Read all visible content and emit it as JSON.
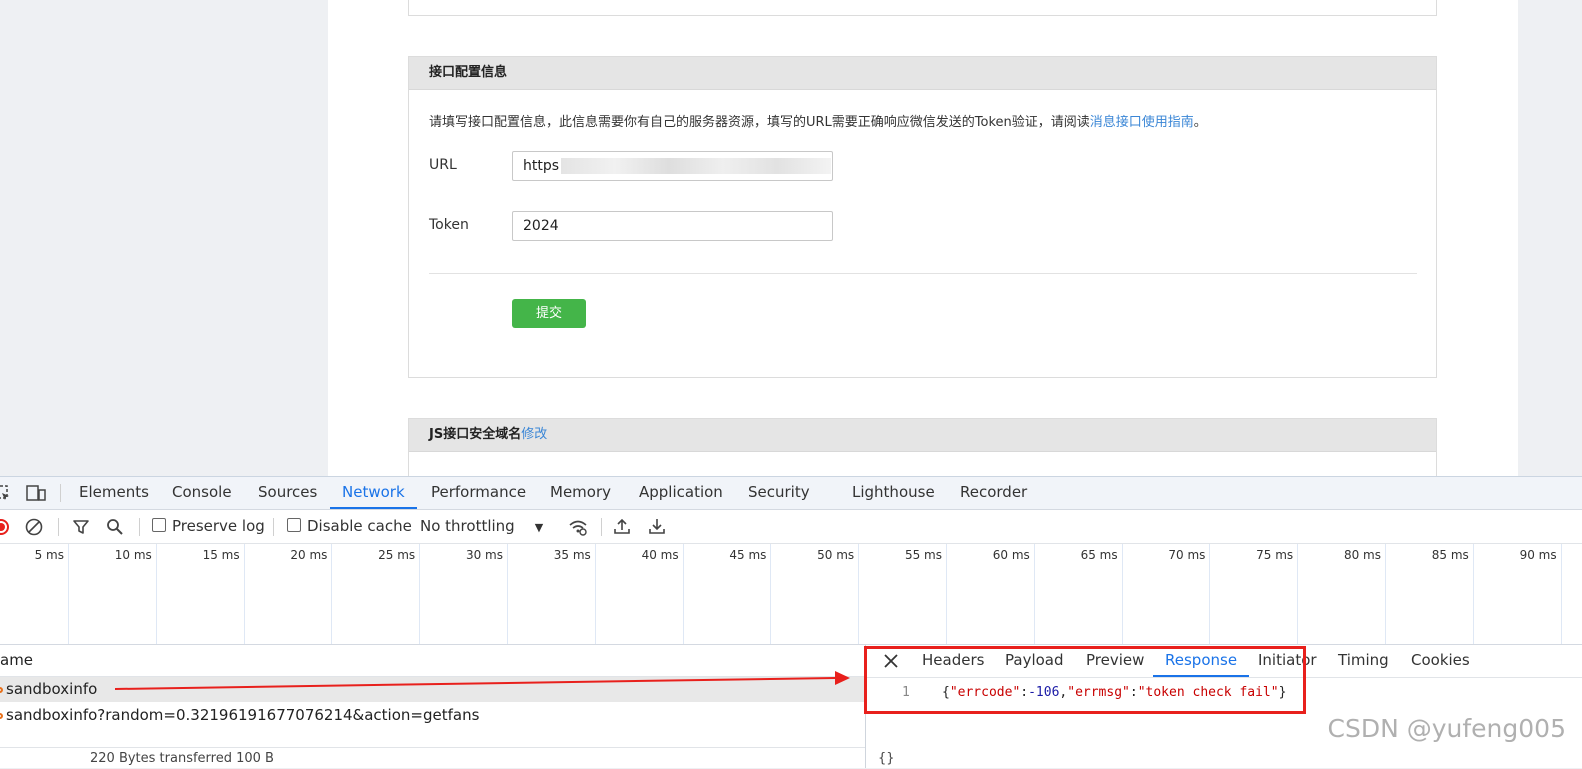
{
  "webpage": {
    "config_panel": {
      "title": "接口配置信息",
      "description_prefix": "请填写接口配置信息，此信息需要你有自己的服务器资源，填写的URL需要正确响应微信发送的Token验证，请阅读",
      "description_link": "消息接口使用指南",
      "description_suffix": "。",
      "url_label": "URL",
      "url_value": "https",
      "token_label": "Token",
      "token_value": "2024",
      "submit_label": "提交"
    },
    "js_panel": {
      "title": "JS接口安全域名",
      "edit_link": "修改"
    }
  },
  "devtools": {
    "tabs": [
      "Elements",
      "Console",
      "Sources",
      "Network",
      "Performance",
      "Memory",
      "Application",
      "Security",
      "Lighthouse",
      "Recorder"
    ],
    "active_tab": "Network",
    "toolbar": {
      "preserve_log": "Preserve log",
      "disable_cache": "Disable cache",
      "throttling": "No throttling"
    },
    "timeline_ticks": [
      "5 ms",
      "10 ms",
      "15 ms",
      "20 ms",
      "25 ms",
      "30 ms",
      "35 ms",
      "40 ms",
      "45 ms",
      "50 ms",
      "55 ms",
      "60 ms",
      "65 ms",
      "70 ms",
      "75 ms",
      "80 ms",
      "85 ms",
      "90 ms"
    ],
    "name_column": "ame",
    "requests": [
      {
        "name": "sandboxinfo"
      },
      {
        "name": "sandboxinfo?random=0.32196191677076214&action=getfans"
      }
    ],
    "status_bar": "220 Bytes transferred   100 B",
    "detail_tabs": [
      "Headers",
      "Payload",
      "Preview",
      "Response",
      "Initiator",
      "Timing",
      "Cookies"
    ],
    "active_detail_tab": "Response",
    "response": {
      "line_number": "1",
      "errcode_key": "\"errcode\"",
      "errcode_value": "-106",
      "errmsg_key": "\"errmsg\"",
      "errmsg_value": "\"token check fail\""
    }
  },
  "watermark": "CSDN @yufeng005",
  "colors": {
    "accent_blue": "#1a73e8",
    "submit_green": "#44b549",
    "annotation_red": "#e8201c",
    "link_blue": "#3a86d6"
  }
}
